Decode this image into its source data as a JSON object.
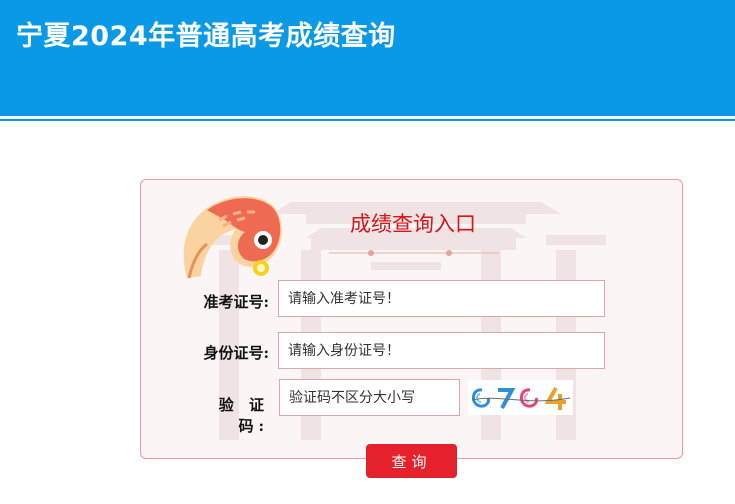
{
  "header": {
    "title": "宁夏2024年普通高考成绩查询"
  },
  "panel": {
    "title": "成绩查询入口"
  },
  "form": {
    "exam_number": {
      "label": "准考证号:",
      "placeholder": "请输入准考证号！",
      "value": ""
    },
    "id_number": {
      "label": "身份证号:",
      "placeholder": "请输入身份证号！",
      "value": ""
    },
    "captcha": {
      "label": "验 证 码:",
      "placeholder": "验证码不区分大小写",
      "value": "",
      "image_text": "C7C4"
    },
    "submit_label": "查询"
  },
  "colors": {
    "header_bg": "#0a99e7",
    "panel_border": "#ec9aa2",
    "panel_title": "#d4151c",
    "button_bg": "#e5222b"
  },
  "icons": [
    "koi-fish-icon",
    "captcha-image"
  ]
}
